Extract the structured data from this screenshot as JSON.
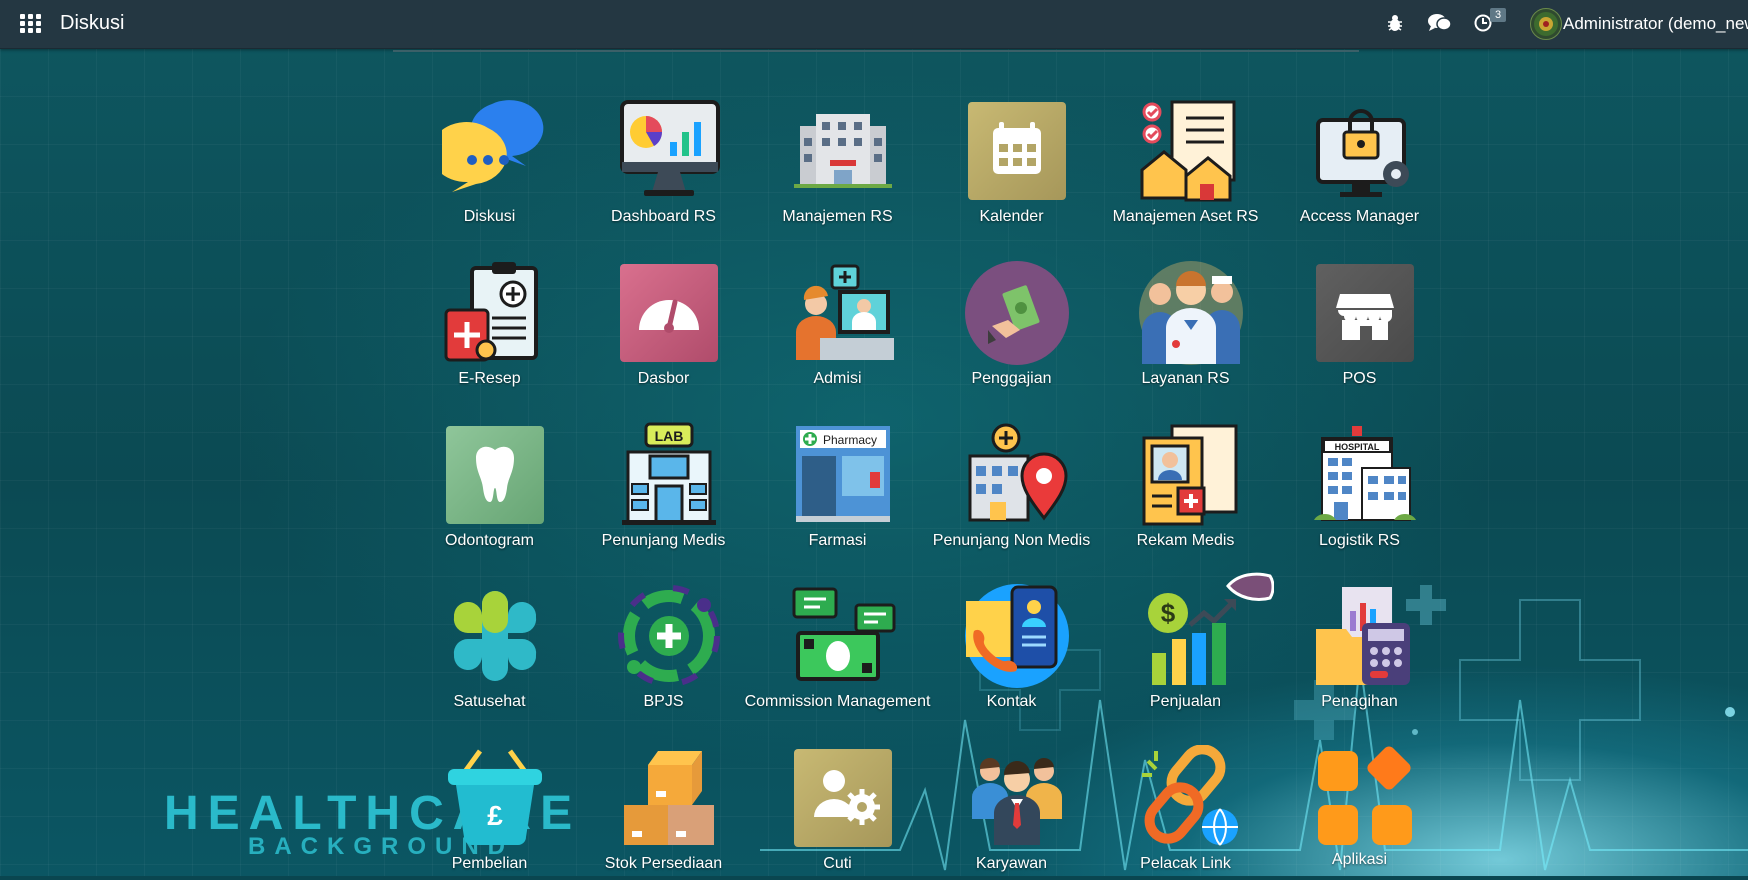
{
  "topbar": {
    "title": "Diskusi",
    "activity_count": "3",
    "user_label": "Administrator (demo_new"
  },
  "apps": [
    {
      "label": "Diskusi",
      "icon": "chat-bubbles-icon"
    },
    {
      "label": "Dashboard RS",
      "icon": "dashboard-monitor-icon"
    },
    {
      "label": "Manajemen RS",
      "icon": "hospital-building-icon"
    },
    {
      "label": "Kalender",
      "icon": "calendar-icon"
    },
    {
      "label": "Manajemen Aset RS",
      "icon": "asset-checklist-icon"
    },
    {
      "label": "Access Manager",
      "icon": "lock-monitor-icon"
    },
    {
      "label": "E-Resep",
      "icon": "prescription-icon"
    },
    {
      "label": "Dasbor",
      "icon": "speedometer-icon"
    },
    {
      "label": "Admisi",
      "icon": "admission-desk-icon"
    },
    {
      "label": "Penggajian",
      "icon": "payroll-money-icon"
    },
    {
      "label": "Layanan RS",
      "icon": "medical-staff-icon"
    },
    {
      "label": "POS",
      "icon": "store-icon"
    },
    {
      "label": "Odontogram",
      "icon": "tooth-icon"
    },
    {
      "label": "Penunjang Medis",
      "icon": "lab-building-icon"
    },
    {
      "label": "Farmasi",
      "icon": "pharmacy-store-icon"
    },
    {
      "label": "Penunjang Non Medis",
      "icon": "location-building-icon"
    },
    {
      "label": "Rekam Medis",
      "icon": "medical-record-icon"
    },
    {
      "label": "Logistik RS",
      "icon": "hospital-logistics-icon"
    },
    {
      "label": "Satusehat",
      "icon": "satusehat-icon"
    },
    {
      "label": "BPJS",
      "icon": "bpjs-icon"
    },
    {
      "label": "Commission Management",
      "icon": "commission-money-icon"
    },
    {
      "label": "Kontak",
      "icon": "contact-phone-icon"
    },
    {
      "label": "Penjualan",
      "icon": "sales-chart-icon"
    },
    {
      "label": "Penagihan",
      "icon": "invoice-calculator-icon"
    },
    {
      "label": "Pembelian",
      "icon": "shopping-basket-icon"
    },
    {
      "label": "Stok Persediaan",
      "icon": "stock-boxes-icon"
    },
    {
      "label": "Cuti",
      "icon": "user-settings-icon"
    },
    {
      "label": "Karyawan",
      "icon": "employees-icon"
    },
    {
      "label": "Pelacak Link",
      "icon": "link-tracker-icon"
    },
    {
      "label": "Aplikasi",
      "icon": "apps-grid-icon"
    }
  ],
  "background": {
    "line1": "HEALTHCARE",
    "line2": "BACKGROUND"
  },
  "colors": {
    "topbar": "#243742",
    "background": "#0b4a53"
  }
}
